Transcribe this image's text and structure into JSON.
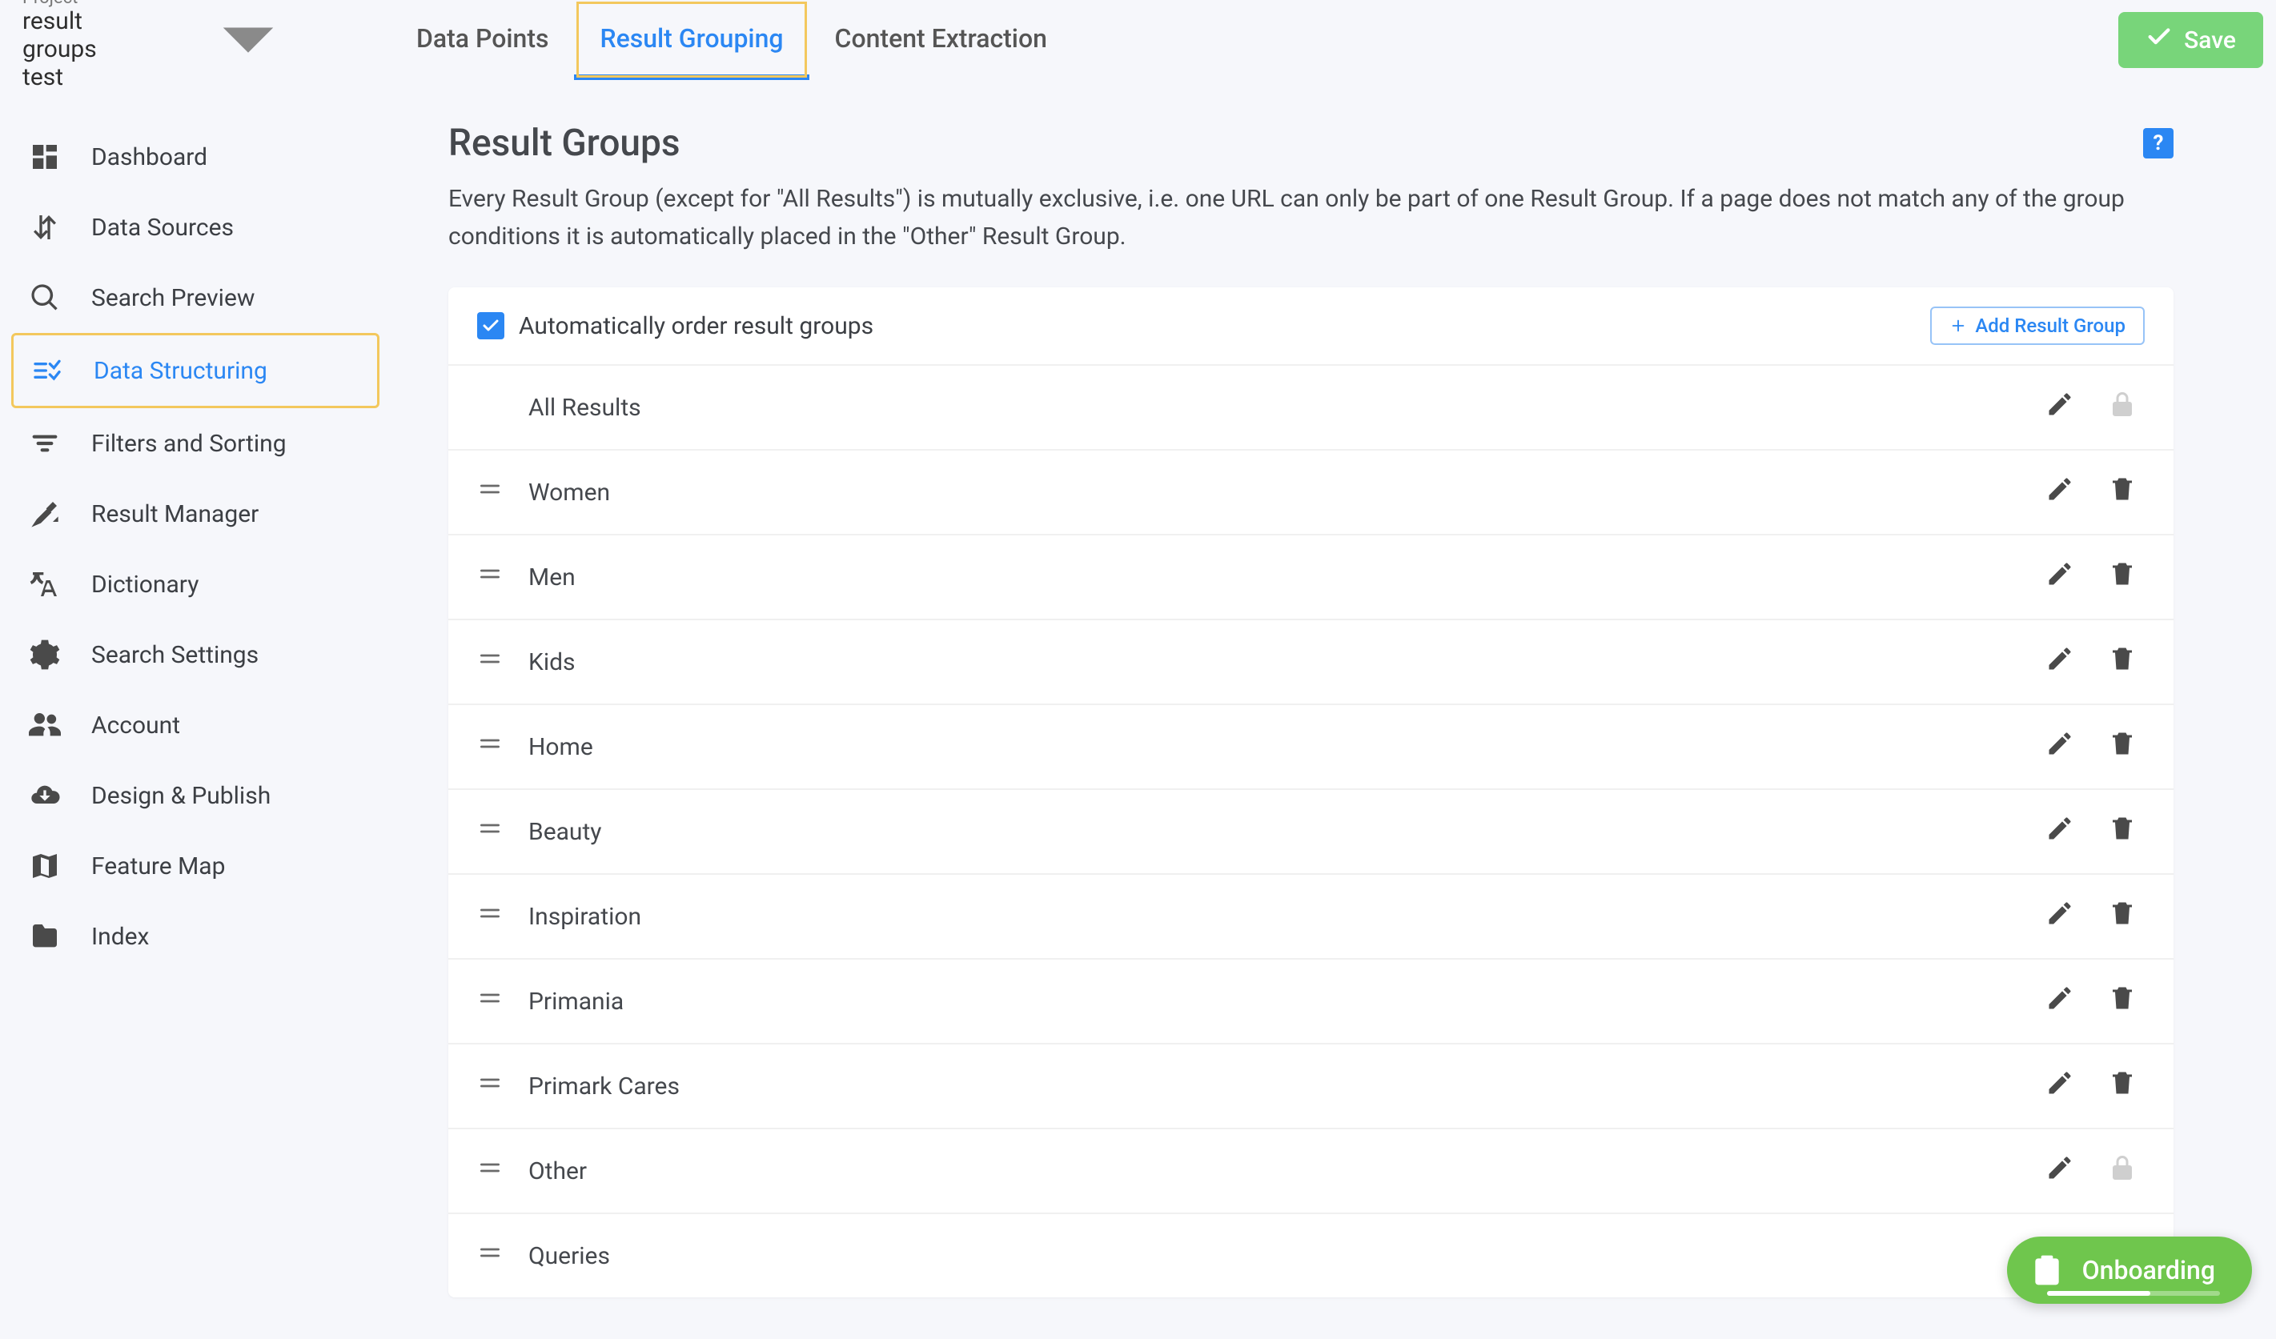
{
  "project": {
    "label": "Project",
    "name": "result groups test"
  },
  "tabs": {
    "data_points": "Data Points",
    "result_grouping": "Result Grouping",
    "content_extraction": "Content Extraction"
  },
  "save_label": "Save",
  "sidebar": {
    "items": [
      {
        "id": "dashboard",
        "label": "Dashboard"
      },
      {
        "id": "data-sources",
        "label": "Data Sources"
      },
      {
        "id": "search-preview",
        "label": "Search Preview"
      },
      {
        "id": "data-structuring",
        "label": "Data Structuring",
        "active": true
      },
      {
        "id": "filters-sorting",
        "label": "Filters and Sorting"
      },
      {
        "id": "result-manager",
        "label": "Result Manager"
      },
      {
        "id": "dictionary",
        "label": "Dictionary"
      },
      {
        "id": "search-settings",
        "label": "Search Settings"
      },
      {
        "id": "account",
        "label": "Account"
      },
      {
        "id": "design-publish",
        "label": "Design & Publish"
      },
      {
        "id": "feature-map",
        "label": "Feature Map"
      },
      {
        "id": "index",
        "label": "Index"
      }
    ]
  },
  "page": {
    "title": "Result Groups",
    "description": "Every Result Group (except for \"All Results\") is mutually exclusive, i.e. one URL can only be part of one Result Group. If a page does not match any of the group conditions it is automatically placed in the \"Other\" Result Group.",
    "checkbox_label": "Automatically order result groups",
    "add_button_label": "Add Result Group",
    "help_badge": "?"
  },
  "groups": [
    {
      "name": "All Results",
      "draggable": false,
      "editable": true,
      "locked": true
    },
    {
      "name": "Women",
      "draggable": true,
      "editable": true,
      "deletable": true
    },
    {
      "name": "Men",
      "draggable": true,
      "editable": true,
      "deletable": true
    },
    {
      "name": "Kids",
      "draggable": true,
      "editable": true,
      "deletable": true
    },
    {
      "name": "Home",
      "draggable": true,
      "editable": true,
      "deletable": true
    },
    {
      "name": "Beauty",
      "draggable": true,
      "editable": true,
      "deletable": true
    },
    {
      "name": "Inspiration",
      "draggable": true,
      "editable": true,
      "deletable": true
    },
    {
      "name": "Primania",
      "draggable": true,
      "editable": true,
      "deletable": true
    },
    {
      "name": "Primark Cares",
      "draggable": true,
      "editable": true,
      "deletable": true
    },
    {
      "name": "Other",
      "draggable": true,
      "editable": true,
      "locked": true
    },
    {
      "name": "Queries",
      "draggable": true,
      "editable": true,
      "locked": true
    }
  ],
  "onboarding": {
    "label": "Onboarding",
    "progress_percent": 60
  },
  "colors": {
    "accent": "#2b87f3",
    "highlight": "#f3c85d",
    "success": "#6fc64d",
    "save_button": "#78d57a"
  }
}
